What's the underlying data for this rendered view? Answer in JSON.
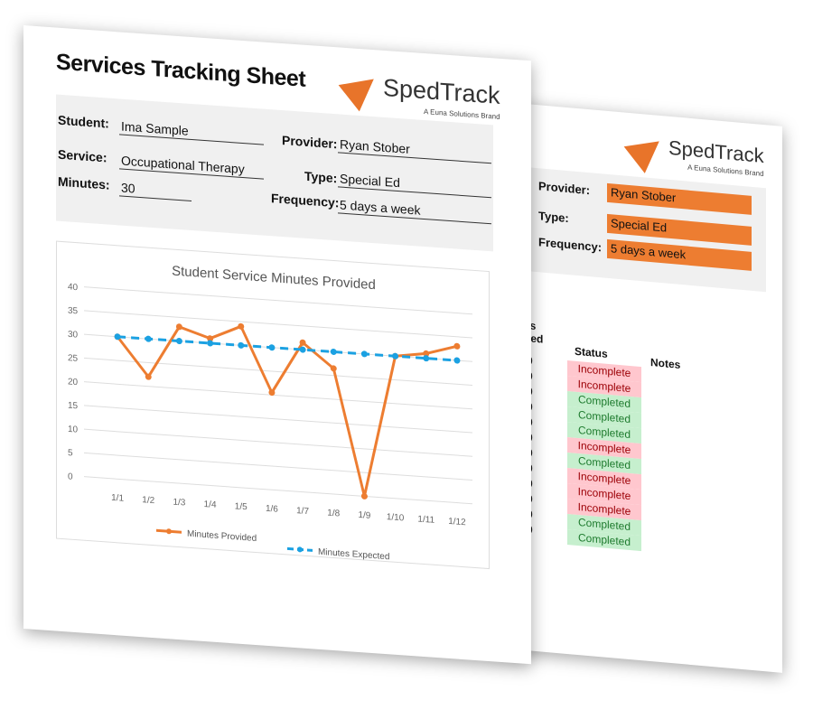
{
  "logo": {
    "name": "SpedTrack",
    "tagline": "A Euna Solutions Brand",
    "color": "#e8742a"
  },
  "front": {
    "title": "Services Tracking Sheet",
    "fields": {
      "student_label": "Student:",
      "student": "Ima Sample",
      "service_label": "Service:",
      "service": "Occupational Therapy",
      "minutes_label": "Minutes:",
      "minutes": "30",
      "provider_label": "Provider:",
      "provider": "Ryan Stober",
      "type_label": "Type:",
      "type": "Special Ed",
      "frequency_label": "Frequency:",
      "frequency": "5 days a week"
    }
  },
  "chart_data": {
    "type": "line",
    "title": "Student Service Minutes Provided",
    "categories": [
      "1/1",
      "1/2",
      "1/3",
      "1/4",
      "1/5",
      "1/6",
      "1/7",
      "1/8",
      "1/9",
      "1/10",
      "1/11",
      "1/12"
    ],
    "yticks": [
      "0",
      "5",
      "10",
      "15",
      "20",
      "25",
      "30",
      "35",
      "40"
    ],
    "ylim": [
      0,
      40
    ],
    "grid": true,
    "legend": "bottom",
    "series": [
      {
        "name": "Minutes Provided",
        "color": "#ed7d31",
        "style": "solid",
        "values": [
          30,
          22,
          33,
          31,
          34,
          20.5,
          31.5,
          26.5,
          0,
          30,
          31,
          33
        ]
      },
      {
        "name": "Minutes Expected",
        "color": "#1ba1e2",
        "style": "dashed",
        "values": [
          30,
          30,
          30,
          30,
          30,
          30,
          30,
          30,
          30,
          30,
          30,
          30
        ]
      }
    ]
  },
  "back": {
    "provider_label": "Provider:",
    "provider": "Ryan Stober",
    "type_label": "Type:",
    "type": "Special Ed",
    "frequency_label": "Frequency:",
    "frequency": "5 days a week",
    "table": {
      "headers": {
        "expected": "Minutes Expected",
        "status": "Status",
        "notes": "Notes"
      },
      "rows": [
        {
          "expected": "30",
          "status": "Incomplete"
        },
        {
          "expected": "30",
          "status": "Incomplete"
        },
        {
          "expected": "30",
          "status": "Completed"
        },
        {
          "expected": "30",
          "status": "Completed"
        },
        {
          "expected": "30",
          "status": "Completed"
        },
        {
          "expected": "30",
          "status": "Incomplete"
        },
        {
          "expected": "30",
          "status": "Completed"
        },
        {
          "expected": "30",
          "status": "Incomplete"
        },
        {
          "expected": "30",
          "status": "Incomplete"
        },
        {
          "expected": "30",
          "status": "Incomplete"
        },
        {
          "expected": "30",
          "status": "Completed"
        },
        {
          "expected": "30",
          "status": "Completed"
        }
      ]
    }
  }
}
